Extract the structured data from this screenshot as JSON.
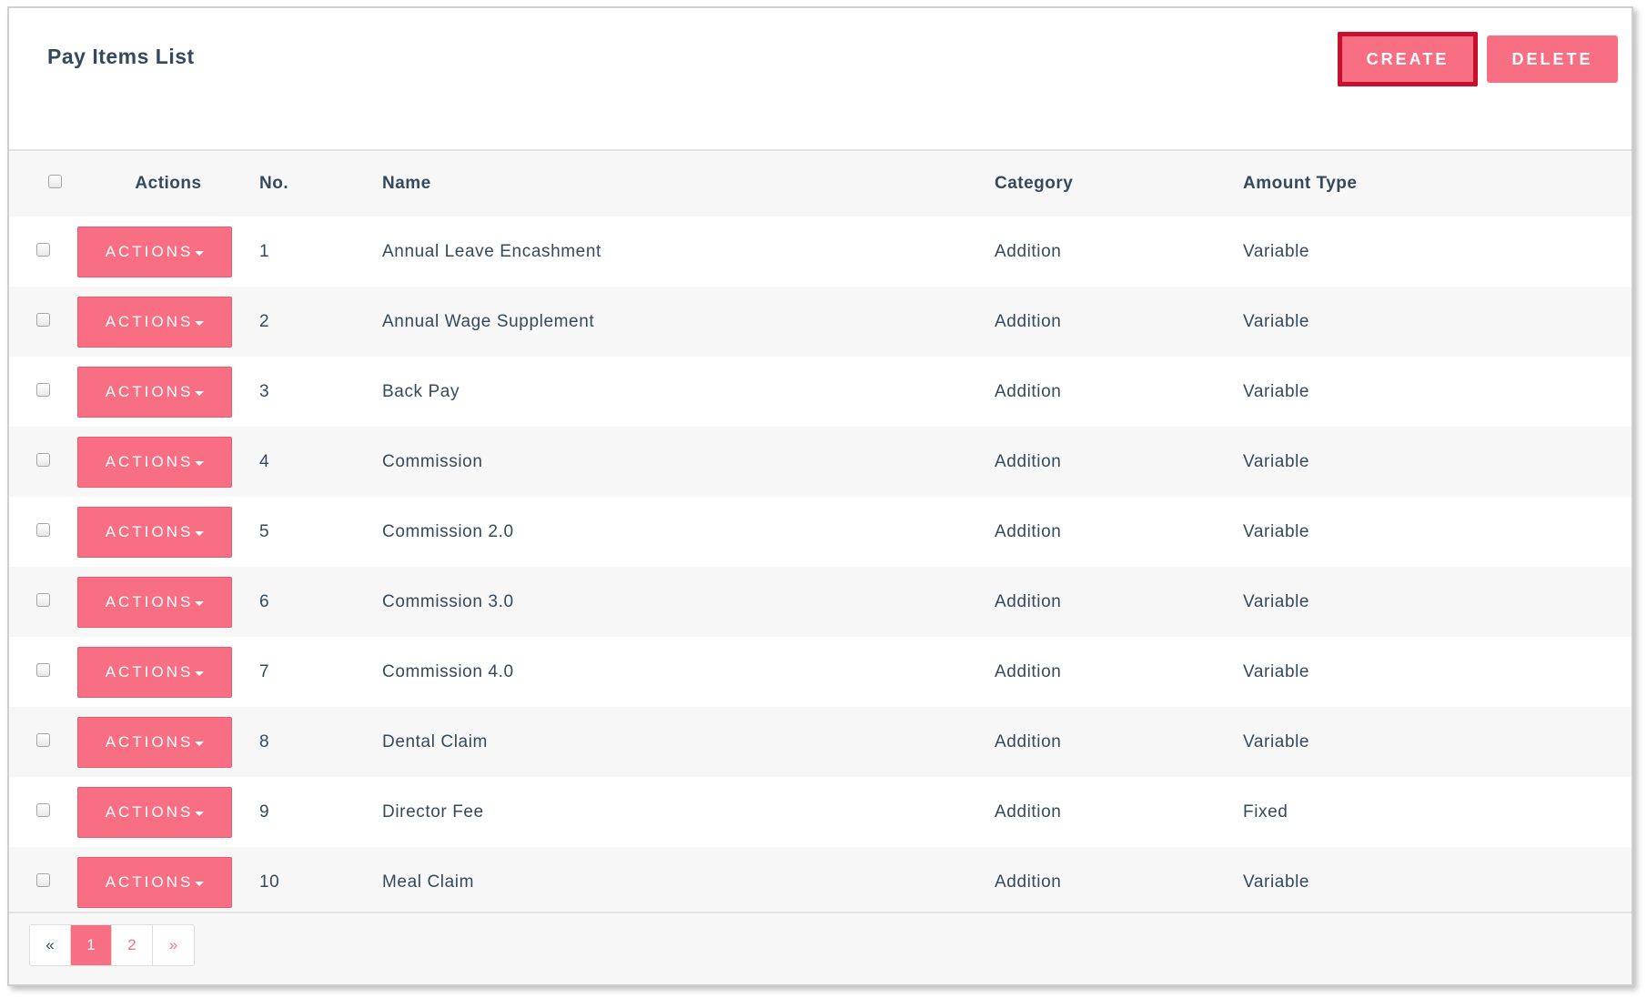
{
  "panel": {
    "title": "Pay Items List",
    "create_label": "CREATE",
    "delete_label": "DELETE"
  },
  "table": {
    "headers": {
      "actions": "Actions",
      "no": "No.",
      "name": "Name",
      "category": "Category",
      "amount_type": "Amount Type"
    },
    "action_label": "ACTIONS",
    "rows": [
      {
        "no": "1",
        "name": "Annual Leave Encashment",
        "category": "Addition",
        "amount_type": "Variable"
      },
      {
        "no": "2",
        "name": "Annual Wage Supplement",
        "category": "Addition",
        "amount_type": "Variable"
      },
      {
        "no": "3",
        "name": "Back Pay",
        "category": "Addition",
        "amount_type": "Variable"
      },
      {
        "no": "4",
        "name": "Commission",
        "category": "Addition",
        "amount_type": "Variable"
      },
      {
        "no": "5",
        "name": "Commission 2.0",
        "category": "Addition",
        "amount_type": "Variable"
      },
      {
        "no": "6",
        "name": "Commission 3.0",
        "category": "Addition",
        "amount_type": "Variable"
      },
      {
        "no": "7",
        "name": "Commission 4.0",
        "category": "Addition",
        "amount_type": "Variable"
      },
      {
        "no": "8",
        "name": "Dental Claim",
        "category": "Addition",
        "amount_type": "Variable"
      },
      {
        "no": "9",
        "name": "Director Fee",
        "category": "Addition",
        "amount_type": "Fixed"
      },
      {
        "no": "10",
        "name": "Meal Claim",
        "category": "Addition",
        "amount_type": "Variable"
      }
    ]
  },
  "pagination": {
    "prev": "«",
    "pages": [
      "1",
      "2"
    ],
    "next": "»",
    "current": "1"
  },
  "colors": {
    "accent": "#f86e82",
    "highlight_border": "#b3001b",
    "text": "#34495e"
  }
}
